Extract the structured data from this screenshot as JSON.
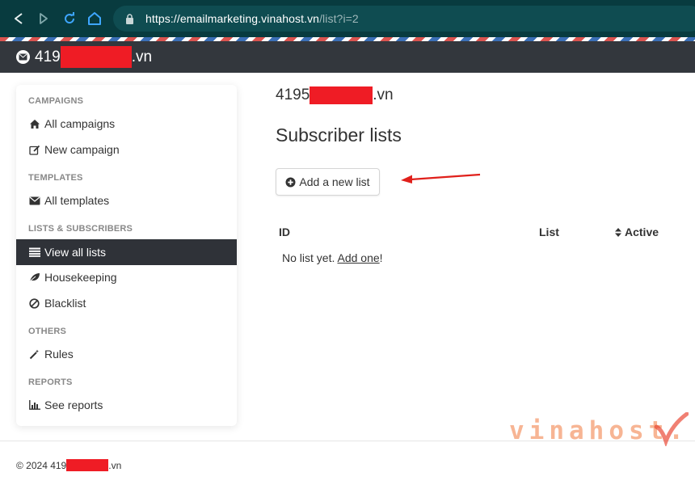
{
  "browser": {
    "url_domain": "https://emailmarketing.vinahost.vn",
    "url_path": "/list?i=2"
  },
  "header": {
    "brand_prefix": "419",
    "brand_suffix": ".vn"
  },
  "sidebar": {
    "sections": [
      {
        "label": "CAMPAIGNS"
      },
      {
        "label": "TEMPLATES"
      },
      {
        "label": "LISTS & SUBSCRIBERS"
      },
      {
        "label": "OTHERS"
      },
      {
        "label": "REPORTS"
      }
    ],
    "items": [
      {
        "label": "All campaigns",
        "icon": "home-icon"
      },
      {
        "label": "New campaign",
        "icon": "edit-icon"
      },
      {
        "label": "All templates",
        "icon": "envelope-icon"
      },
      {
        "label": "View all lists",
        "icon": "list-icon",
        "active": true
      },
      {
        "label": "Housekeeping",
        "icon": "leaf-icon"
      },
      {
        "label": "Blacklist",
        "icon": "ban-icon"
      },
      {
        "label": "Rules",
        "icon": "magic-wand-icon"
      },
      {
        "label": "See reports",
        "icon": "bar-chart-icon"
      }
    ]
  },
  "main": {
    "site_prefix": "4195",
    "site_suffix": ".vn",
    "page_title": "Subscriber lists",
    "add_button_label": "Add a new list",
    "table": {
      "columns": [
        "ID",
        "List",
        "Active"
      ],
      "empty_text": "No list yet.",
      "empty_link": "Add one",
      "empty_suffix": "!"
    }
  },
  "footer": {
    "copyright_prefix": "© 2024 419",
    "copyright_suffix": ".vn"
  },
  "watermark": "vinahost.",
  "colors": {
    "header_bg": "#33373d",
    "active_item_bg": "#2f3238",
    "redaction": "#ef1c25",
    "annotation_arrow": "#e0201b"
  }
}
